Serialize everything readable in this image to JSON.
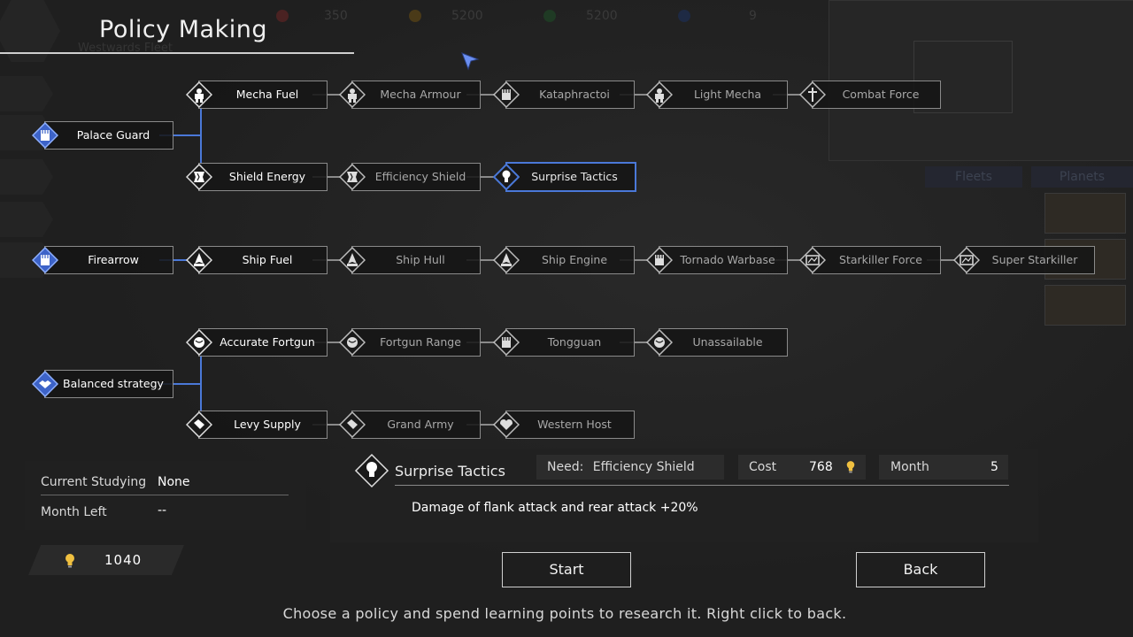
{
  "screen_title": "Policy Making",
  "background": {
    "resources": [
      "350",
      "5200",
      "5200",
      "9"
    ],
    "fleet_label": "Westwards Fleet",
    "tabs": [
      "Fleets",
      "Planets"
    ]
  },
  "tree": {
    "row1": {
      "root": "Palace Guard",
      "upper": [
        "Mecha Fuel",
        "Mecha Armour",
        "Kataphractoi",
        "Light Mecha",
        "Combat Force"
      ],
      "lower": [
        "Shield Energy",
        "Efficiency Shield",
        "Surprise Tactics"
      ]
    },
    "row2": {
      "root": "Firearrow",
      "chain": [
        "Ship Fuel",
        "Ship Hull",
        "Ship Engine",
        "Tornado Warbase",
        "Starkiller Force",
        "Super Starkiller"
      ]
    },
    "row3": {
      "root": "Balanced strategy",
      "upper": [
        "Accurate Fortgun",
        "Fortgun Range",
        "Tongguan",
        "Unassailable"
      ],
      "lower": [
        "Levy Supply",
        "Grand Army",
        "Western Host"
      ]
    }
  },
  "study": {
    "current_label": "Current Studying",
    "current_value": "None",
    "month_label": "Month Left",
    "month_value": "--"
  },
  "learning_points": "1040",
  "detail": {
    "name": "Surprise Tactics",
    "need_label": "Need:",
    "need_value": "Efficiency Shield",
    "cost_label": "Cost",
    "cost_value": "768",
    "month_label": "Month",
    "month_value": "5",
    "description": "Damage of flank attack and rear attack +20%"
  },
  "buttons": {
    "start": "Start",
    "back": "Back"
  },
  "hint": "Choose a policy and spend learning points to research it. Right click to back.",
  "colors": {
    "accent": "#4a78d8",
    "unlocked": "#ffffff",
    "locked": "#a8a8a8",
    "bulb": "#f0c040"
  }
}
